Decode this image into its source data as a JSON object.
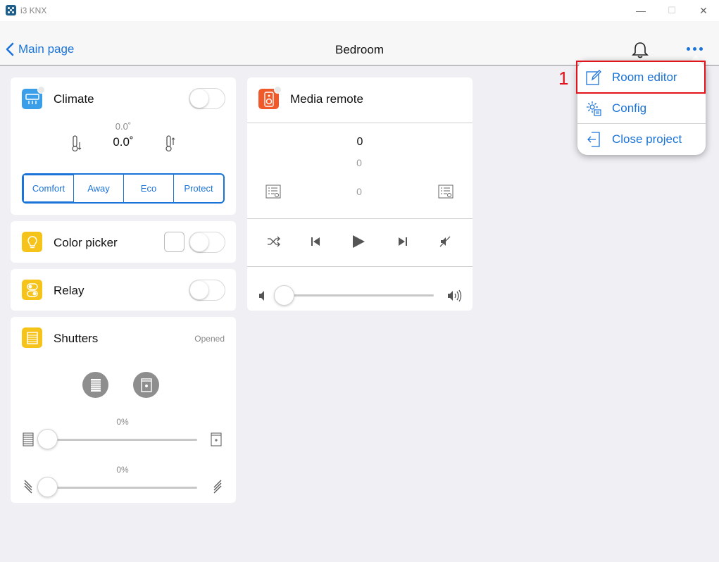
{
  "window": {
    "title": "i3 KNX",
    "minimize": "—",
    "maximize": "☐",
    "close": "✕"
  },
  "header": {
    "back_label": "Main page",
    "title": "Bedroom"
  },
  "climate": {
    "title": "Climate",
    "setpoint": "0.0˚",
    "current": "0.0˚",
    "modes": [
      "Comfort",
      "Away",
      "Eco",
      "Protect"
    ]
  },
  "color_picker": {
    "title": "Color picker"
  },
  "relay": {
    "title": "Relay"
  },
  "shutters": {
    "title": "Shutters",
    "status": "Opened",
    "position_label": "0%",
    "tilt_label": "0%",
    "position_fraction": 0,
    "tilt_fraction": 0
  },
  "media": {
    "title": "Media remote",
    "value_main": "0",
    "value_sub": "0",
    "value_track": "0",
    "volume_fraction": 0
  },
  "menu": {
    "items": [
      {
        "label": "Room editor",
        "icon": "edit-icon"
      },
      {
        "label": "Config",
        "icon": "gear-config-icon"
      },
      {
        "label": "Close project",
        "icon": "exit-icon"
      }
    ]
  },
  "annotation": {
    "number": "1",
    "color": "#e0141a"
  },
  "colors": {
    "accent": "#1a73d9",
    "climate_icon": "#3b9ee8",
    "color_icon": "#f6c31a",
    "media_icon": "#f05a2a"
  }
}
